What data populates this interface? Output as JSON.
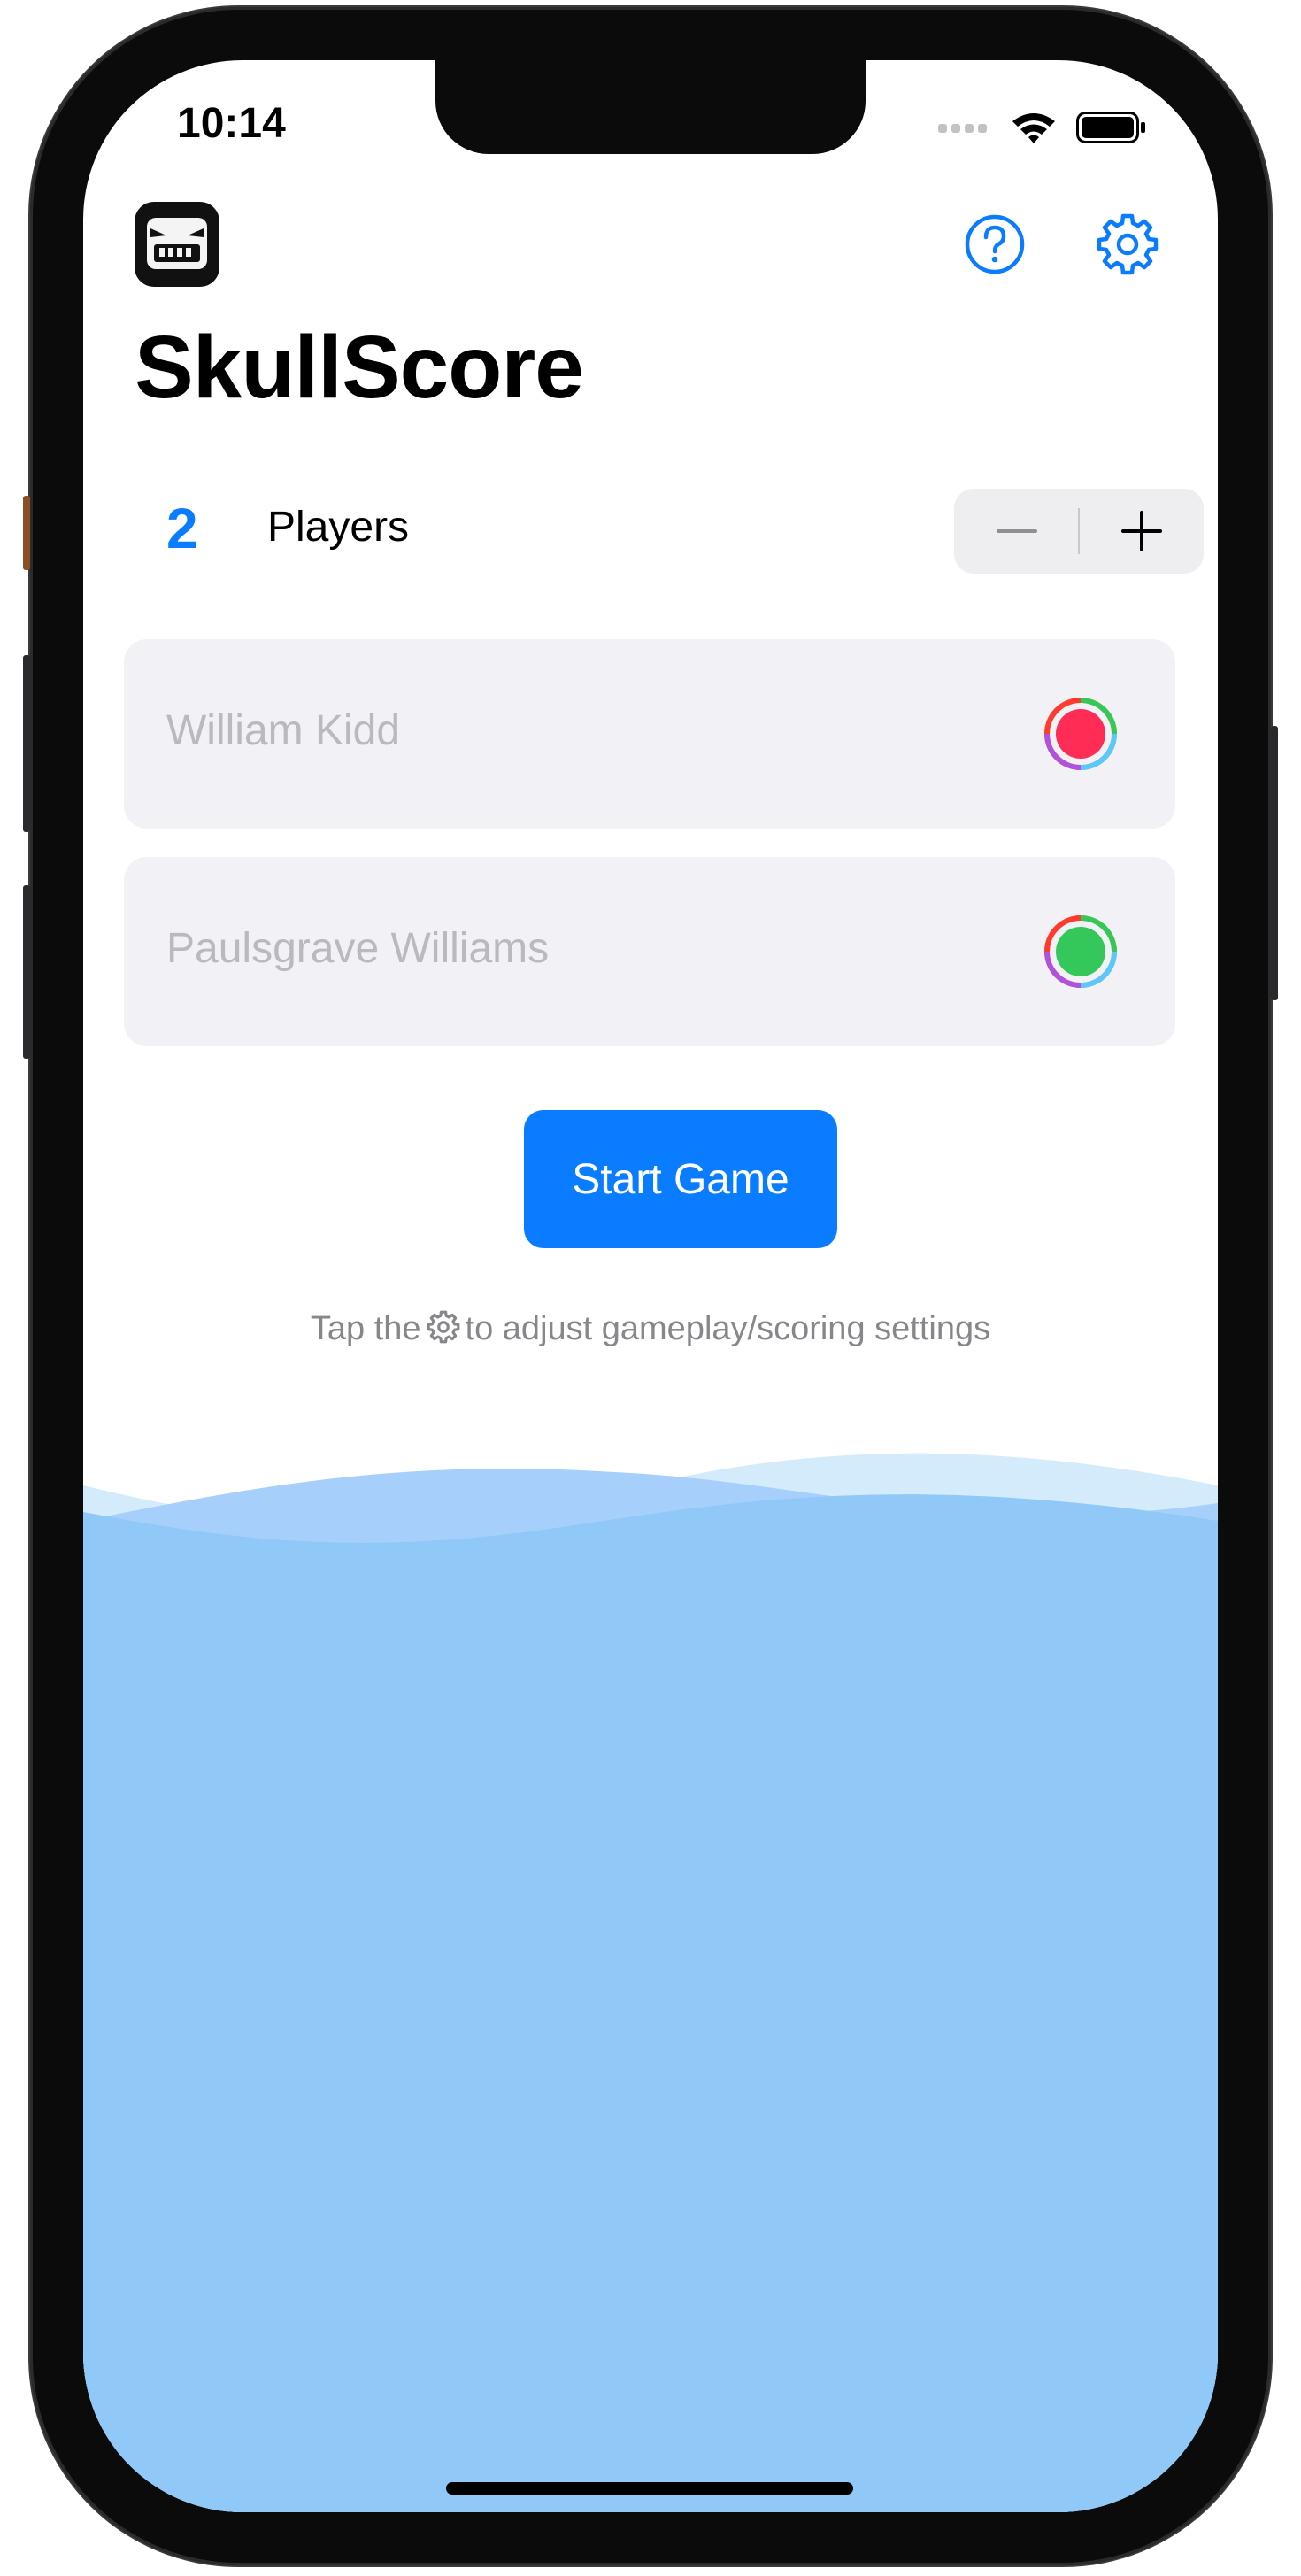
{
  "status": {
    "time": "10:14"
  },
  "app": {
    "title": "SkullScore"
  },
  "toolbar": {
    "help_icon": "question-circle-icon",
    "settings_icon": "gear-icon"
  },
  "players": {
    "count": "2",
    "label": "Players",
    "list": [
      {
        "placeholder": "William Kidd",
        "color": "#ff2d55"
      },
      {
        "placeholder": "Paulsgrave Williams",
        "color": "#34c759"
      }
    ]
  },
  "actions": {
    "start_label": "Start Game"
  },
  "hint": {
    "before": "Tap the",
    "after": "to adjust gameplay/scoring settings"
  },
  "colors": {
    "accent": "#0a7cff",
    "wave_main": "#90c8f8",
    "wave_mid": "#a6d0fb",
    "wave_light": "#d4ebfb"
  }
}
